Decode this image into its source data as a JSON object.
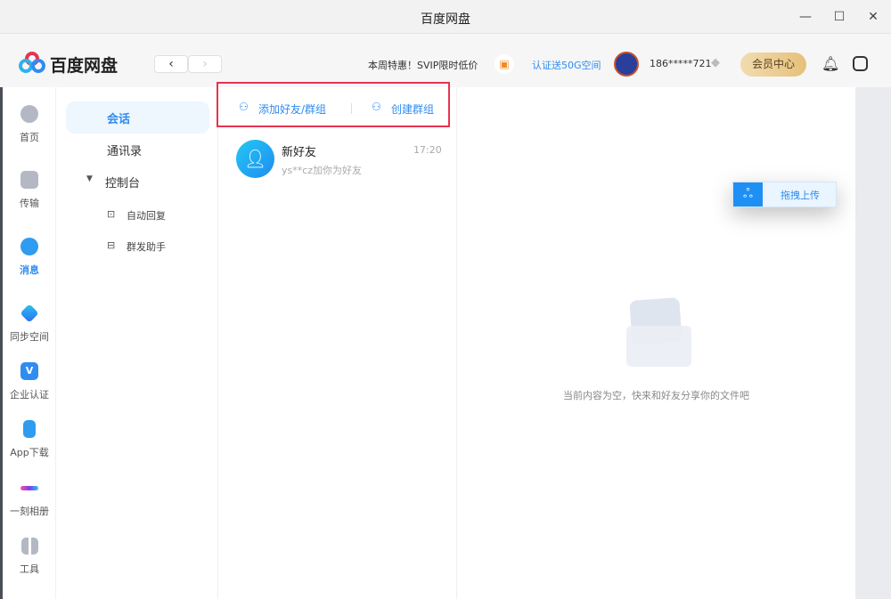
{
  "window": {
    "title": "百度网盘",
    "minimize": "—",
    "maximize": "☐",
    "close": "✕"
  },
  "header": {
    "logo_text": "百度网盘",
    "back": "‹",
    "forward": "›",
    "promo": "本周特惠！SVIP限时低价",
    "verify_link": "认证送50G空间",
    "username": "186*****721",
    "vip_button": "会员中心"
  },
  "rail": [
    {
      "label": "首页"
    },
    {
      "label": "传输"
    },
    {
      "label": "消息"
    },
    {
      "label": "同步空间"
    },
    {
      "label": "企业认证"
    },
    {
      "label": "App下载"
    },
    {
      "label": "一刻相册"
    },
    {
      "label": "工具"
    }
  ],
  "nav": {
    "items": [
      {
        "label": "会话"
      },
      {
        "label": "通讯录"
      },
      {
        "label": "控制台"
      }
    ],
    "sub": [
      {
        "label": "自动回复"
      },
      {
        "label": "群发助手"
      }
    ]
  },
  "actions": {
    "add_friend": "添加好友/群组",
    "create_group": "创建群组"
  },
  "conversations": [
    {
      "name": "新好友",
      "time": "17:20",
      "preview": "ys**cz加你为好友"
    }
  ],
  "main": {
    "empty_text": "当前内容为空，快来和好友分享你的文件吧",
    "drag_upload": "拖拽上传"
  },
  "colors": {
    "accent": "#2f8cf0",
    "highlight": "#e8334f",
    "vip": "#e9c98a"
  }
}
